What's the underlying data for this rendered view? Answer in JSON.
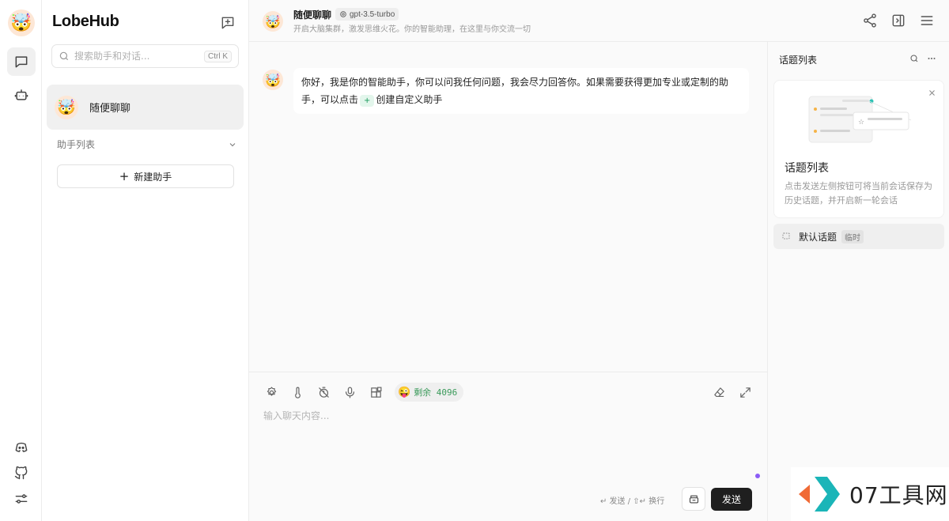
{
  "app": {
    "brand": "LobeHub"
  },
  "search": {
    "placeholder": "搜索助手和对话...",
    "shortcut": "Ctrl K"
  },
  "sessions": [
    {
      "title": "随便聊聊",
      "avatar": "🤯"
    }
  ],
  "assistant_group": {
    "label": "助手列表",
    "new_button": "新建助手"
  },
  "header": {
    "title": "随便聊聊",
    "model": "gpt-3.5-turbo",
    "description": "开启大脑集群，激发思维火花。你的智能助理，在这里与你交流一切"
  },
  "message": {
    "part1": "你好，我是你的智能助手，你可以问我任何问题，我会尽力回答你。如果需要获得更加专业或定制的助手，可以点击",
    "chip": "+",
    "part2": "创建自定义助手"
  },
  "input": {
    "placeholder": "输入聊天内容...",
    "token_emoji": "😜",
    "token_label": "剩余 4096",
    "hint": "↵ 发送 / ⇧↵ 换行",
    "send_label": "发送"
  },
  "topics": {
    "title": "话题列表",
    "guide_title": "话题列表",
    "guide_desc": "点击发送左侧按钮可将当前会话保存为历史话题，并开启新一轮会话",
    "items": [
      {
        "label": "默认话题",
        "badge": "临时"
      }
    ]
  },
  "watermark": {
    "text": "07工具网"
  },
  "colors": {
    "accent_dark": "#1f1f1f",
    "token_green": "#3a9a5a",
    "status_dot": "#8b5cf6",
    "watermark_orange": "#f06a35",
    "watermark_teal": "#1bb5b8"
  }
}
